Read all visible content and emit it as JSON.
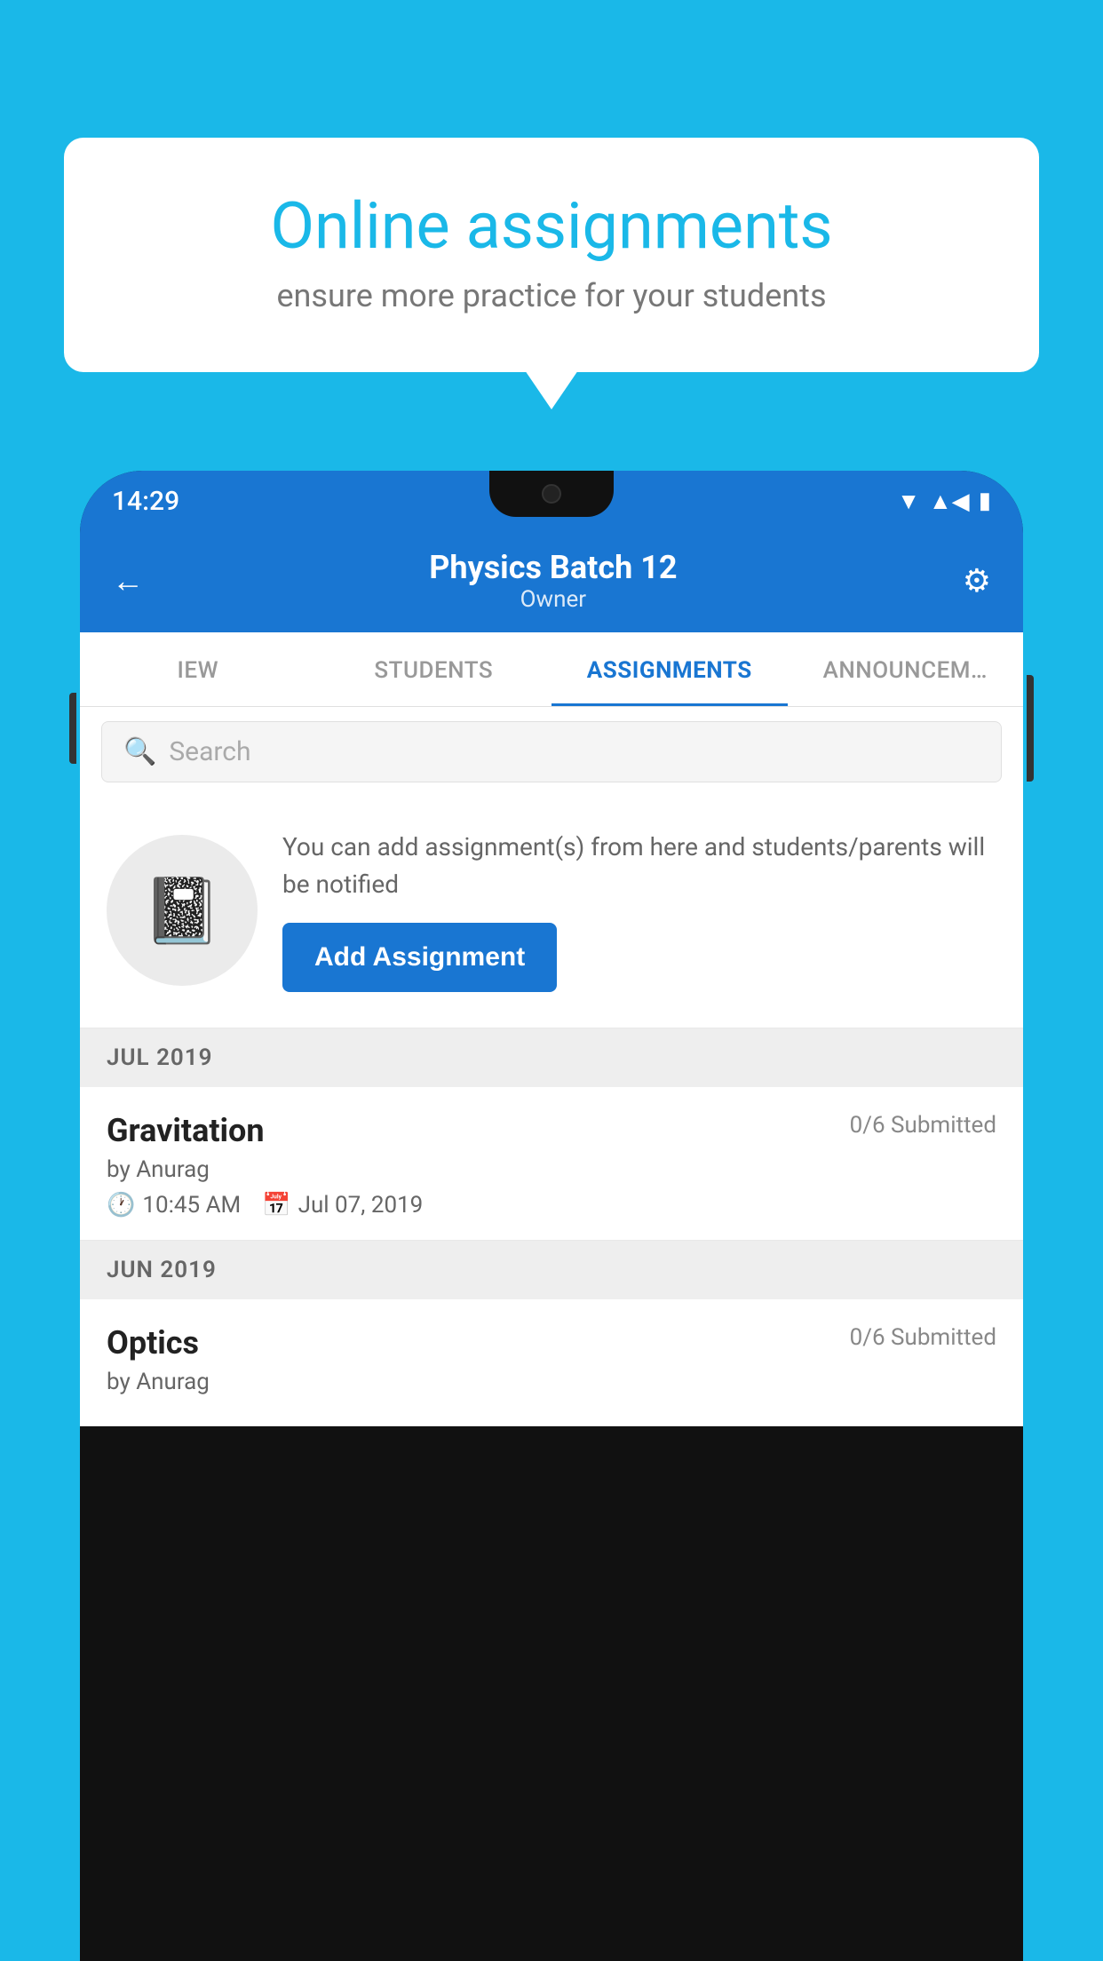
{
  "background_color": "#1ab8e8",
  "speech_bubble": {
    "title": "Online assignments",
    "subtitle": "ensure more practice for your students"
  },
  "phone": {
    "status_bar": {
      "time": "14:29",
      "icons": [
        "wifi",
        "signal",
        "battery"
      ]
    },
    "header": {
      "title": "Physics Batch 12",
      "subtitle": "Owner",
      "back_label": "←",
      "settings_label": "⚙"
    },
    "tabs": [
      {
        "label": "IEW",
        "active": false
      },
      {
        "label": "STUDENTS",
        "active": false
      },
      {
        "label": "ASSIGNMENTS",
        "active": true
      },
      {
        "label": "ANNOUNCEM…",
        "active": false
      }
    ],
    "search": {
      "placeholder": "Search"
    },
    "promo_card": {
      "description": "You can add assignment(s) from here and students/parents will be notified",
      "button_label": "Add Assignment"
    },
    "sections": [
      {
        "label": "JUL 2019",
        "assignments": [
          {
            "title": "Gravitation",
            "submitted": "0/6 Submitted",
            "by": "by Anurag",
            "time": "10:45 AM",
            "date": "Jul 07, 2019"
          }
        ]
      },
      {
        "label": "JUN 2019",
        "assignments": [
          {
            "title": "Optics",
            "submitted": "0/6 Submitted",
            "by": "by Anurag",
            "time": "",
            "date": ""
          }
        ]
      }
    ]
  }
}
